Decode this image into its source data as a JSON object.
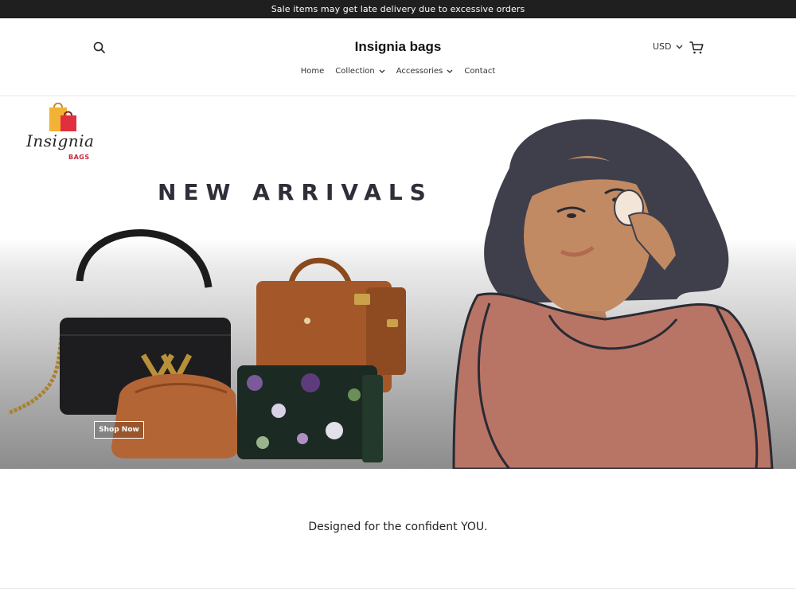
{
  "announcement": {
    "text": "Sale items may get late delivery due to excessive orders"
  },
  "header": {
    "title": "Insignia bags",
    "currency": "USD",
    "icons": {
      "search": "search-icon",
      "cart": "cart-icon",
      "dropdown": "chevron-down-icon"
    },
    "nav": [
      {
        "label": "Home",
        "dropdown": false
      },
      {
        "label": "Collection",
        "dropdown": true
      },
      {
        "label": "Accessories",
        "dropdown": true
      },
      {
        "label": "Contact",
        "dropdown": false
      }
    ]
  },
  "hero": {
    "logo_script": "Insignia",
    "logo_sub": "BAGS",
    "heading": "NEW ARRIVALS",
    "button_label": "Shop Now"
  },
  "section": {
    "tagline": "Designed for the confident YOU."
  },
  "colors": {
    "announcement_bg": "#1f1f1f",
    "logo_accent": "#c62a3a",
    "heading": "#2e2f38"
  }
}
